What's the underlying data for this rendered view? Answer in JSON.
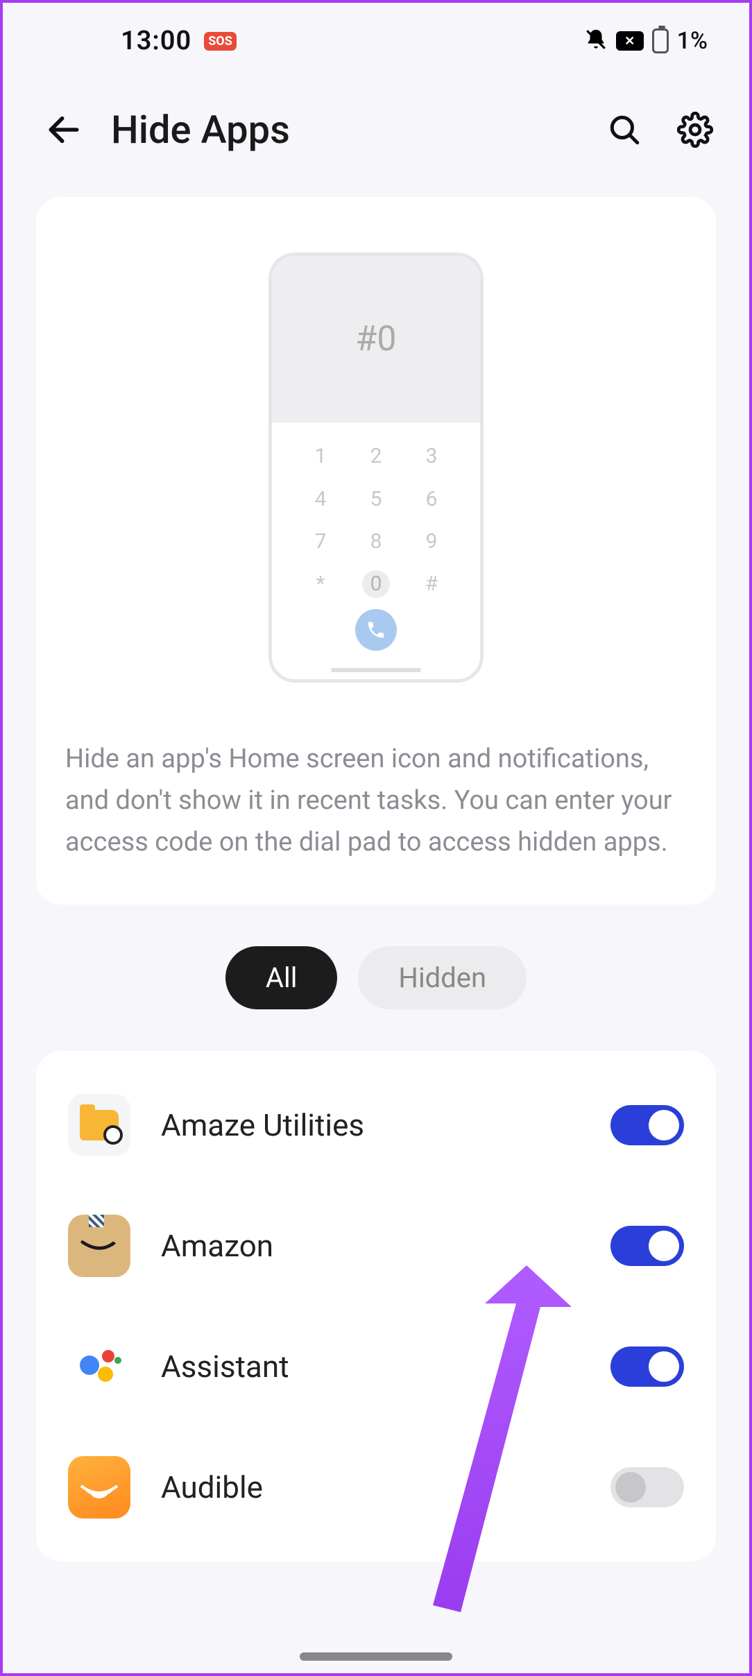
{
  "status": {
    "time": "13:00",
    "sos": "SOS",
    "battery_pct": "1%"
  },
  "header": {
    "title": "Hide Apps"
  },
  "info": {
    "dial_display": "#0",
    "keys": [
      "1",
      "2",
      "3",
      "4",
      "5",
      "6",
      "7",
      "8",
      "9",
      "*",
      "0",
      "#"
    ],
    "description": "Hide an app's Home screen icon and notifications, and don't show it in recent tasks. You can enter your access code on the dial pad to access hidden apps."
  },
  "tabs": {
    "all": "All",
    "hidden": "Hidden",
    "active": "all"
  },
  "apps": [
    {
      "name": "Amaze Utilities",
      "enabled": true,
      "icon": "amaze"
    },
    {
      "name": "Amazon",
      "enabled": true,
      "icon": "amazon"
    },
    {
      "name": "Assistant",
      "enabled": true,
      "icon": "assistant"
    },
    {
      "name": "Audible",
      "enabled": false,
      "icon": "audible"
    }
  ]
}
